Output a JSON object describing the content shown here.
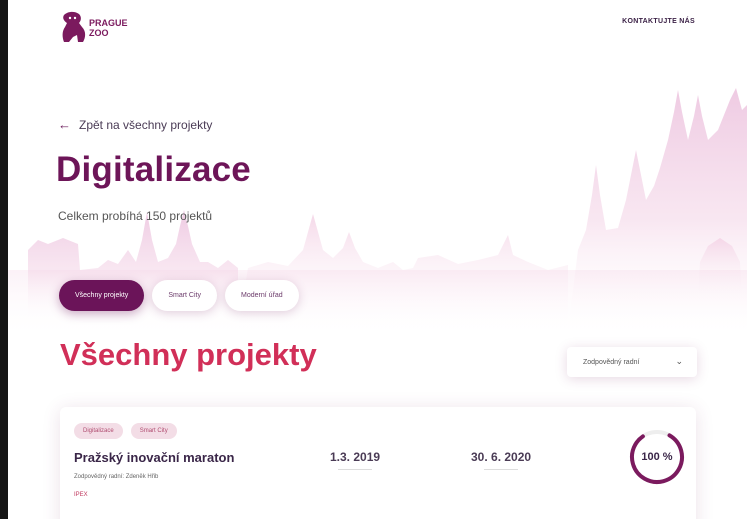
{
  "header": {
    "logo_line1": "PRAGUE",
    "logo_line2": "ZOO",
    "contact_label": "KONTAKTUJTE NÁS"
  },
  "nav": {
    "back_label": "Zpět na všechny projekty"
  },
  "page": {
    "title": "Digitalizace",
    "subtitle": "Celkem probíhá 150 projektů"
  },
  "filters": [
    {
      "label": "Všechny projekty",
      "active": true
    },
    {
      "label": "Smart City",
      "active": false
    },
    {
      "label": "Moderní úřad",
      "active": false
    }
  ],
  "section": {
    "title": "Všechny projekty"
  },
  "sort": {
    "label": "Zodpovědný radní"
  },
  "projects": [
    {
      "tags": [
        "Digitalizace",
        "Smart City"
      ],
      "name": "Pražský inovační maraton",
      "responsible": "Zodpovědný radní: Zdeněk Hřib",
      "code": "IPEX",
      "start_date": "1.3. 2019",
      "end_date": "30. 6. 2020",
      "progress_label": "100 %",
      "progress": 0.82
    }
  ],
  "colors": {
    "brand": "#6d1558",
    "accent": "#d12f58",
    "chip_active": "#6b1459",
    "tag_bg": "#f3dde6"
  },
  "icons": {
    "back": "arrow-left-icon",
    "sort": "chevron-down-icon",
    "logo": "gorilla-logo-icon"
  }
}
